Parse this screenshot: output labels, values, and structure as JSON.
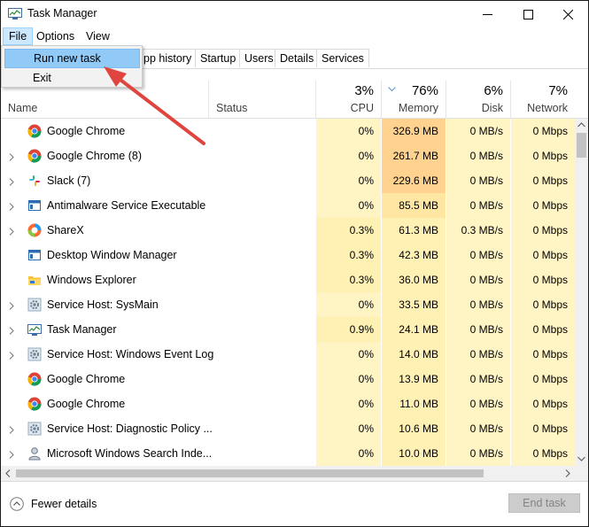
{
  "window": {
    "title": "Task Manager"
  },
  "menu": {
    "file": "File",
    "options": "Options",
    "view": "View"
  },
  "file_menu": {
    "run_new_task": "Run new task",
    "exit": "Exit"
  },
  "tabs": {
    "app_history": "pp history",
    "startup": "Startup",
    "users": "Users",
    "details": "Details",
    "services": "Services"
  },
  "columns": {
    "name": "Name",
    "status": "Status",
    "cpu": {
      "pct": "3%",
      "label": "CPU"
    },
    "memory": {
      "pct": "76%",
      "label": "Memory"
    },
    "disk": {
      "pct": "6%",
      "label": "Disk"
    },
    "network": {
      "pct": "7%",
      "label": "Network"
    }
  },
  "processes": [
    {
      "name": "Google Chrome",
      "icon": "chrome-icon",
      "expand": false,
      "cpu": "0%",
      "memory": "326.9 MB",
      "disk": "0 MB/s",
      "network": "0 Mbps"
    },
    {
      "name": "Google Chrome (8)",
      "icon": "chrome-icon",
      "expand": true,
      "cpu": "0%",
      "memory": "261.7 MB",
      "disk": "0 MB/s",
      "network": "0 Mbps"
    },
    {
      "name": "Slack (7)",
      "icon": "slack-icon",
      "expand": true,
      "cpu": "0%",
      "memory": "229.6 MB",
      "disk": "0 MB/s",
      "network": "0 Mbps"
    },
    {
      "name": "Antimalware Service Executable",
      "icon": "window-app-icon",
      "expand": true,
      "cpu": "0%",
      "memory": "85.5 MB",
      "disk": "0 MB/s",
      "network": "0 Mbps"
    },
    {
      "name": "ShareX",
      "icon": "sharex-icon",
      "expand": true,
      "cpu": "0.3%",
      "memory": "61.3 MB",
      "disk": "0.3 MB/s",
      "network": "0 Mbps"
    },
    {
      "name": "Desktop Window Manager",
      "icon": "window-app-icon",
      "expand": false,
      "cpu": "0.3%",
      "memory": "42.3 MB",
      "disk": "0 MB/s",
      "network": "0 Mbps"
    },
    {
      "name": "Windows Explorer",
      "icon": "folder-icon",
      "expand": false,
      "cpu": "0.3%",
      "memory": "36.0 MB",
      "disk": "0 MB/s",
      "network": "0 Mbps"
    },
    {
      "name": "Service Host: SysMain",
      "icon": "gear-icon",
      "expand": true,
      "cpu": "0%",
      "memory": "33.5 MB",
      "disk": "0 MB/s",
      "network": "0 Mbps"
    },
    {
      "name": "Task Manager",
      "icon": "task-manager-icon",
      "expand": true,
      "cpu": "0.9%",
      "memory": "24.1 MB",
      "disk": "0 MB/s",
      "network": "0 Mbps"
    },
    {
      "name": "Service Host: Windows Event Log",
      "icon": "gear-icon",
      "expand": true,
      "cpu": "0%",
      "memory": "14.0 MB",
      "disk": "0 MB/s",
      "network": "0 Mbps"
    },
    {
      "name": "Google Chrome",
      "icon": "chrome-icon",
      "expand": false,
      "cpu": "0%",
      "memory": "13.9 MB",
      "disk": "0 MB/s",
      "network": "0 Mbps"
    },
    {
      "name": "Google Chrome",
      "icon": "chrome-icon",
      "expand": false,
      "cpu": "0%",
      "memory": "11.0 MB",
      "disk": "0 MB/s",
      "network": "0 Mbps"
    },
    {
      "name": "Service Host: Diagnostic Policy ...",
      "icon": "gear-icon",
      "expand": true,
      "cpu": "0%",
      "memory": "10.6 MB",
      "disk": "0 MB/s",
      "network": "0 Mbps"
    },
    {
      "name": "Microsoft Windows Search Inde...",
      "icon": "search-indexer-icon",
      "expand": true,
      "cpu": "0%",
      "memory": "10.0 MB",
      "disk": "0 MB/s",
      "network": "0 Mbps"
    },
    {
      "name": "",
      "icon": "",
      "expand": false,
      "cpu": "",
      "memory": "",
      "disk": "",
      "network": ""
    }
  ],
  "footer": {
    "fewer_details": "Fewer details",
    "end_task": "End task"
  },
  "colors": {
    "heat_light": "#fff4c4",
    "heat_mid": "#fff0b3",
    "heat_strong": "#ffd28f",
    "heat_memory": "#ffe7a3",
    "menu_highlight": "#91c9f7",
    "arrow": "#e0443f"
  }
}
